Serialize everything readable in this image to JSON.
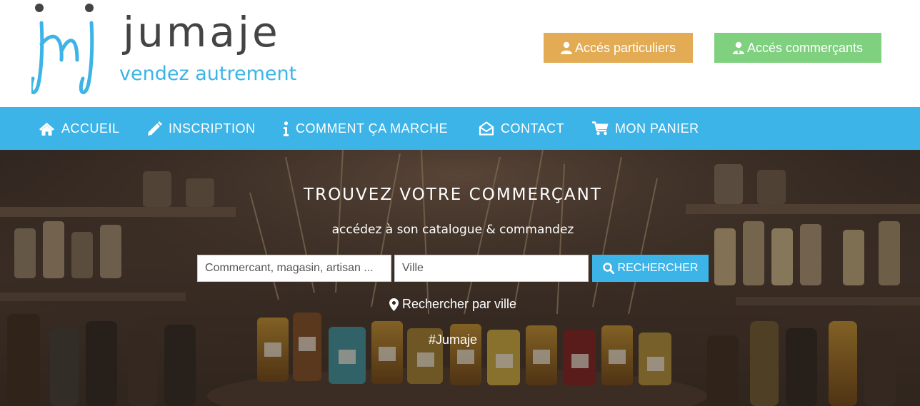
{
  "header": {
    "logo": {
      "brand": "jumaje",
      "tagline": "vendez autrement",
      "monogram_color": "#3db4e8",
      "brand_color": "#444444"
    },
    "access_buttons": {
      "particuliers": {
        "label": "Accés particuliers",
        "color": "#e2ab54",
        "icon": "user-icon"
      },
      "commercants": {
        "label": "Accés commerçants",
        "color": "#7fd17f",
        "icon": "user-tie-icon"
      }
    }
  },
  "nav": {
    "color": "#3db4e8",
    "items": [
      {
        "label": "ACCUEIL",
        "icon": "home-icon"
      },
      {
        "label": "INSCRIPTION",
        "icon": "pencil-icon"
      },
      {
        "label": "COMMENT ÇA MARCHE",
        "icon": "info-icon"
      },
      {
        "label": "CONTACT",
        "icon": "envelope-open-icon"
      },
      {
        "label": "MON PANIER",
        "icon": "cart-icon"
      }
    ]
  },
  "hero": {
    "title": "TROUVEZ VOTRE COMMERÇANT",
    "subtitle": "accédez à son catalogue & commandez",
    "search": {
      "merchant_placeholder": "Commercant, magasin, artisan ...",
      "city_placeholder": "Ville",
      "button_label": "RECHERCHER",
      "button_color": "#3db4e8"
    },
    "city_link": "Rechercher par ville",
    "hashtag": "#Jumaje"
  }
}
